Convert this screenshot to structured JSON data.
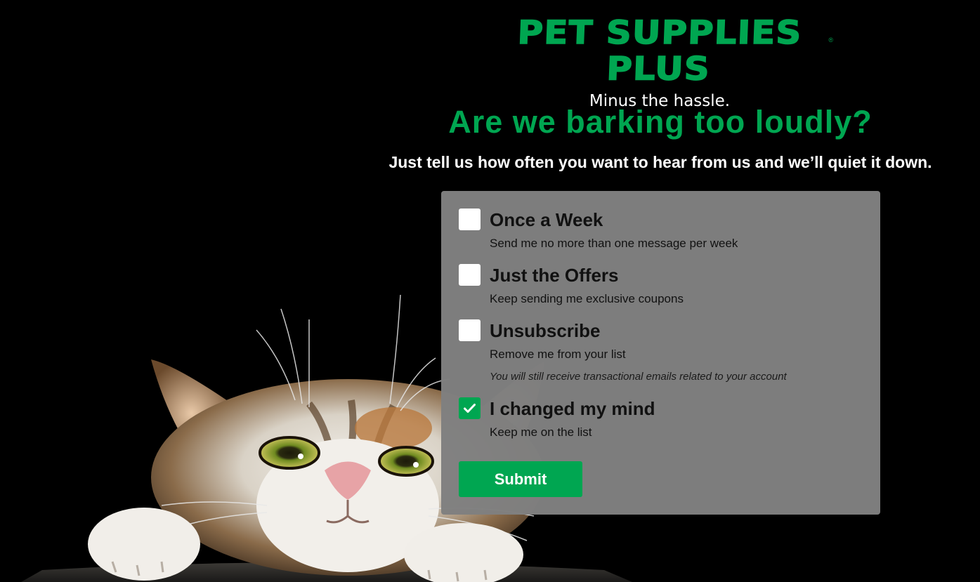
{
  "brand": {
    "logo_text": "PET SUPPLIES PLUS",
    "registered_mark": "®",
    "tagline": "Minus the hassle.",
    "accent_color": "#00a651"
  },
  "hero": {
    "headline": "Are we barking too loudly?",
    "subheadline": "Just tell us how often you want to hear from us and we’ll quiet it down."
  },
  "preferences": {
    "options": [
      {
        "label": "Once a Week",
        "description": "Send me no more than one message per week",
        "checked": false
      },
      {
        "label": "Just the Offers",
        "description": "Keep sending me exclusive coupons",
        "checked": false
      },
      {
        "label": "Unsubscribe",
        "description": "Remove me from your list",
        "note": "You will still receive transactional emails related to your account",
        "checked": false
      },
      {
        "label": "I changed my mind",
        "description": "Keep me on the list",
        "checked": true
      }
    ],
    "submit_label": "Submit"
  },
  "background_image": {
    "subject": "cat-peeking-over-table",
    "icon": "cat-illustration"
  }
}
